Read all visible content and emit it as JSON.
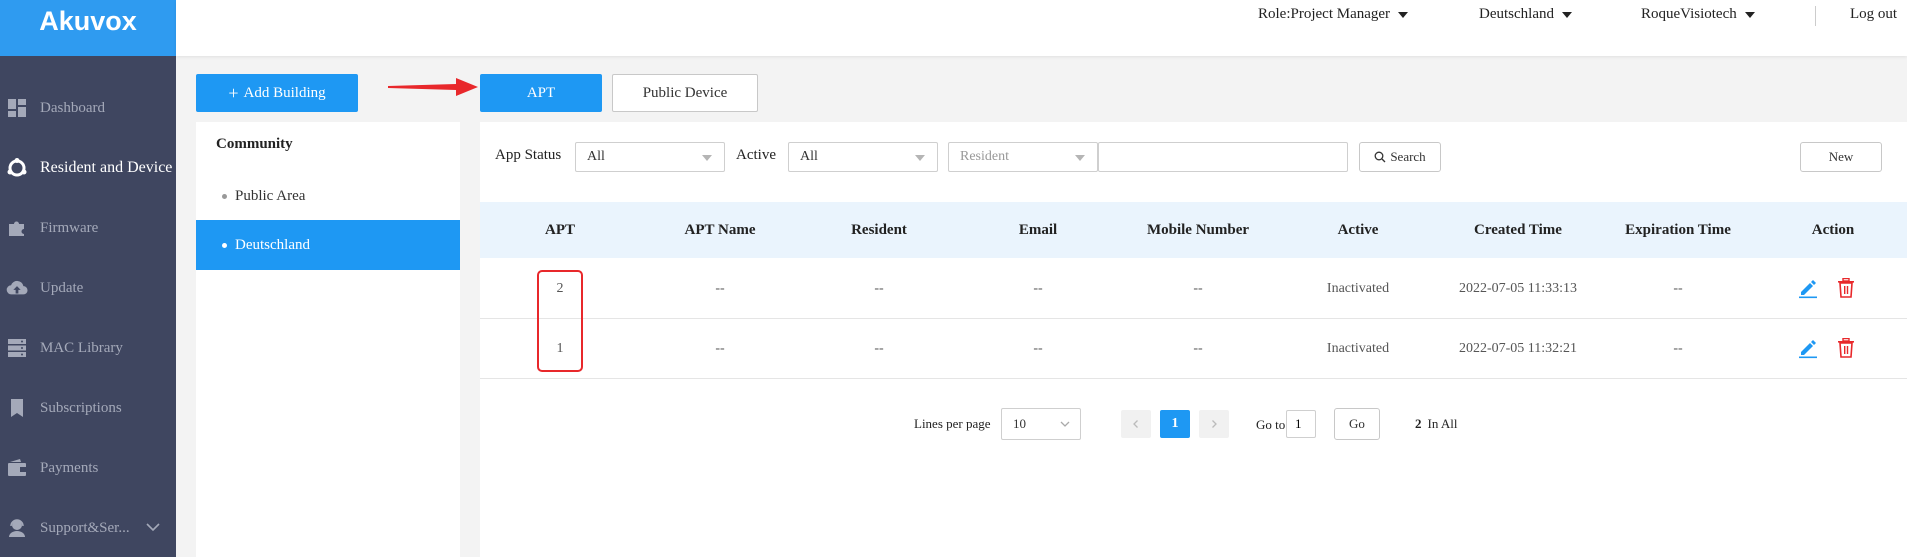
{
  "app": {
    "logo": "Akuvox"
  },
  "sidebar": {
    "items": [
      {
        "label": "Dashboard",
        "icon": "dashboard-icon"
      },
      {
        "label": "Resident and Device",
        "icon": "resident-device-icon"
      },
      {
        "label": "Firmware",
        "icon": "puzzle-icon"
      },
      {
        "label": "Update",
        "icon": "cloud-upload-icon"
      },
      {
        "label": "MAC Library",
        "icon": "server-icon"
      },
      {
        "label": "Subscriptions",
        "icon": "bookmark-icon"
      },
      {
        "label": "Payments",
        "icon": "wallet-icon"
      },
      {
        "label": "Support&Ser...",
        "icon": "support-icon"
      }
    ],
    "active_index": 1
  },
  "header": {
    "role": "Role:Project Manager",
    "community": "Deutschland",
    "user": "RoqueVisiotech",
    "logout": "Log out"
  },
  "toolbar": {
    "add_building": "Add Building",
    "tab_apt": "APT",
    "tab_public_device": "Public Device"
  },
  "community": {
    "title": "Community",
    "items": [
      "Public Area",
      "Deutschland"
    ],
    "selected_index": 1
  },
  "filters": {
    "app_status_label": "App Status",
    "app_status_value": "All",
    "active_label": "Active",
    "active_value": "All",
    "search_type_value": "Resident",
    "search_input_value": "",
    "search_button": "Search",
    "new_button": "New"
  },
  "table": {
    "columns": [
      "APT",
      "APT Name",
      "Resident",
      "Email",
      "Mobile Number",
      "Active",
      "Created Time",
      "Expiration Time",
      "Action"
    ],
    "rows": [
      [
        "2",
        "--",
        "--",
        "--",
        "--",
        "Inactivated",
        "2022-07-05 11:33:13",
        "--"
      ],
      [
        "1",
        "--",
        "--",
        "--",
        "--",
        "Inactivated",
        "2022-07-05 11:32:21",
        "--"
      ]
    ]
  },
  "pagination": {
    "lines_per_page_label": "Lines per page",
    "lines_per_page_value": "10",
    "current_page": "1",
    "goto_label": "Go to",
    "goto_value": "1",
    "go_button": "Go",
    "total_count": "2",
    "total_label": "In All"
  },
  "colors": {
    "brand": "#1e98f3",
    "sidebar_bg": "#3f4660",
    "danger": "#e8282b",
    "annotation": "#e8282b"
  }
}
